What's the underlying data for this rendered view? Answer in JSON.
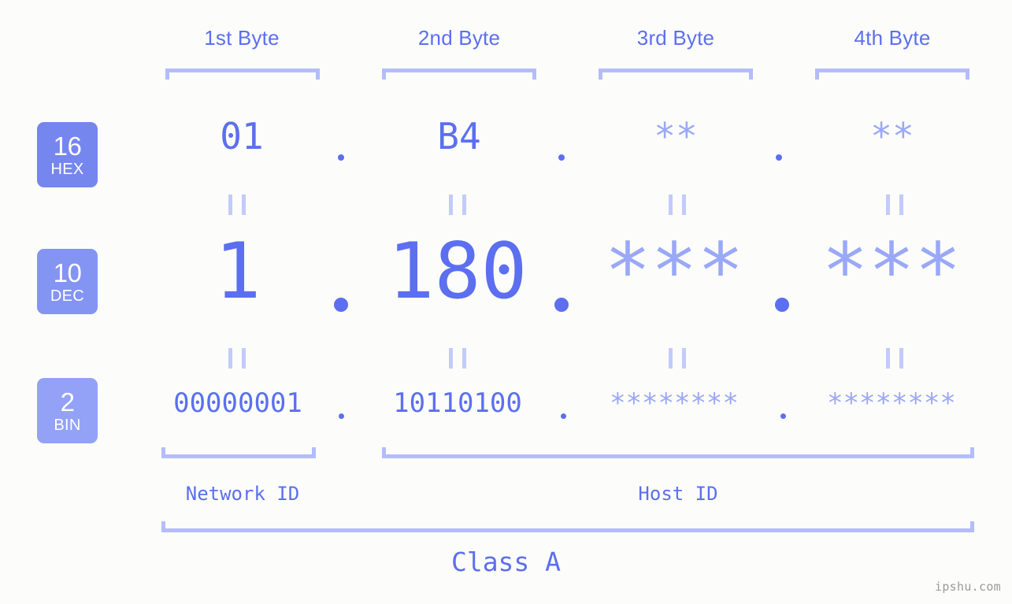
{
  "watermark": "ipshu.com",
  "class_label": "Class A",
  "headers": [
    {
      "label": "1st Byte"
    },
    {
      "label": "2nd Byte"
    },
    {
      "label": "3rd Byte"
    },
    {
      "label": "4th Byte"
    }
  ],
  "radix": [
    {
      "base": "16",
      "name": "HEX",
      "color": "#7686ef"
    },
    {
      "base": "10",
      "name": "DEC",
      "color": "#8494f3"
    },
    {
      "base": "2",
      "name": "BIN",
      "color": "#93a2f7"
    }
  ],
  "rows": {
    "hex": {
      "values": [
        "01",
        "B4",
        "**",
        "**"
      ],
      "known": [
        true,
        true,
        false,
        false
      ]
    },
    "dec": {
      "values": [
        "1",
        "180",
        "***",
        "***"
      ],
      "known": [
        true,
        true,
        false,
        false
      ]
    },
    "bin": {
      "values": [
        "00000001",
        "10110100",
        "********",
        "********"
      ],
      "known": [
        true,
        true,
        false,
        false
      ]
    }
  },
  "separators": {
    "dot": "."
  },
  "equals_marks": {
    "glyph": "||"
  },
  "id_sections": [
    {
      "label": "Network ID"
    },
    {
      "label": "Host ID"
    }
  ],
  "colors": {
    "background": "#fcfdfa",
    "accent": "#5c6ff0",
    "accent_light": "#9aa8f8",
    "bracket": "#b3bdfb",
    "watermark_gray": "#9b9b9b"
  }
}
